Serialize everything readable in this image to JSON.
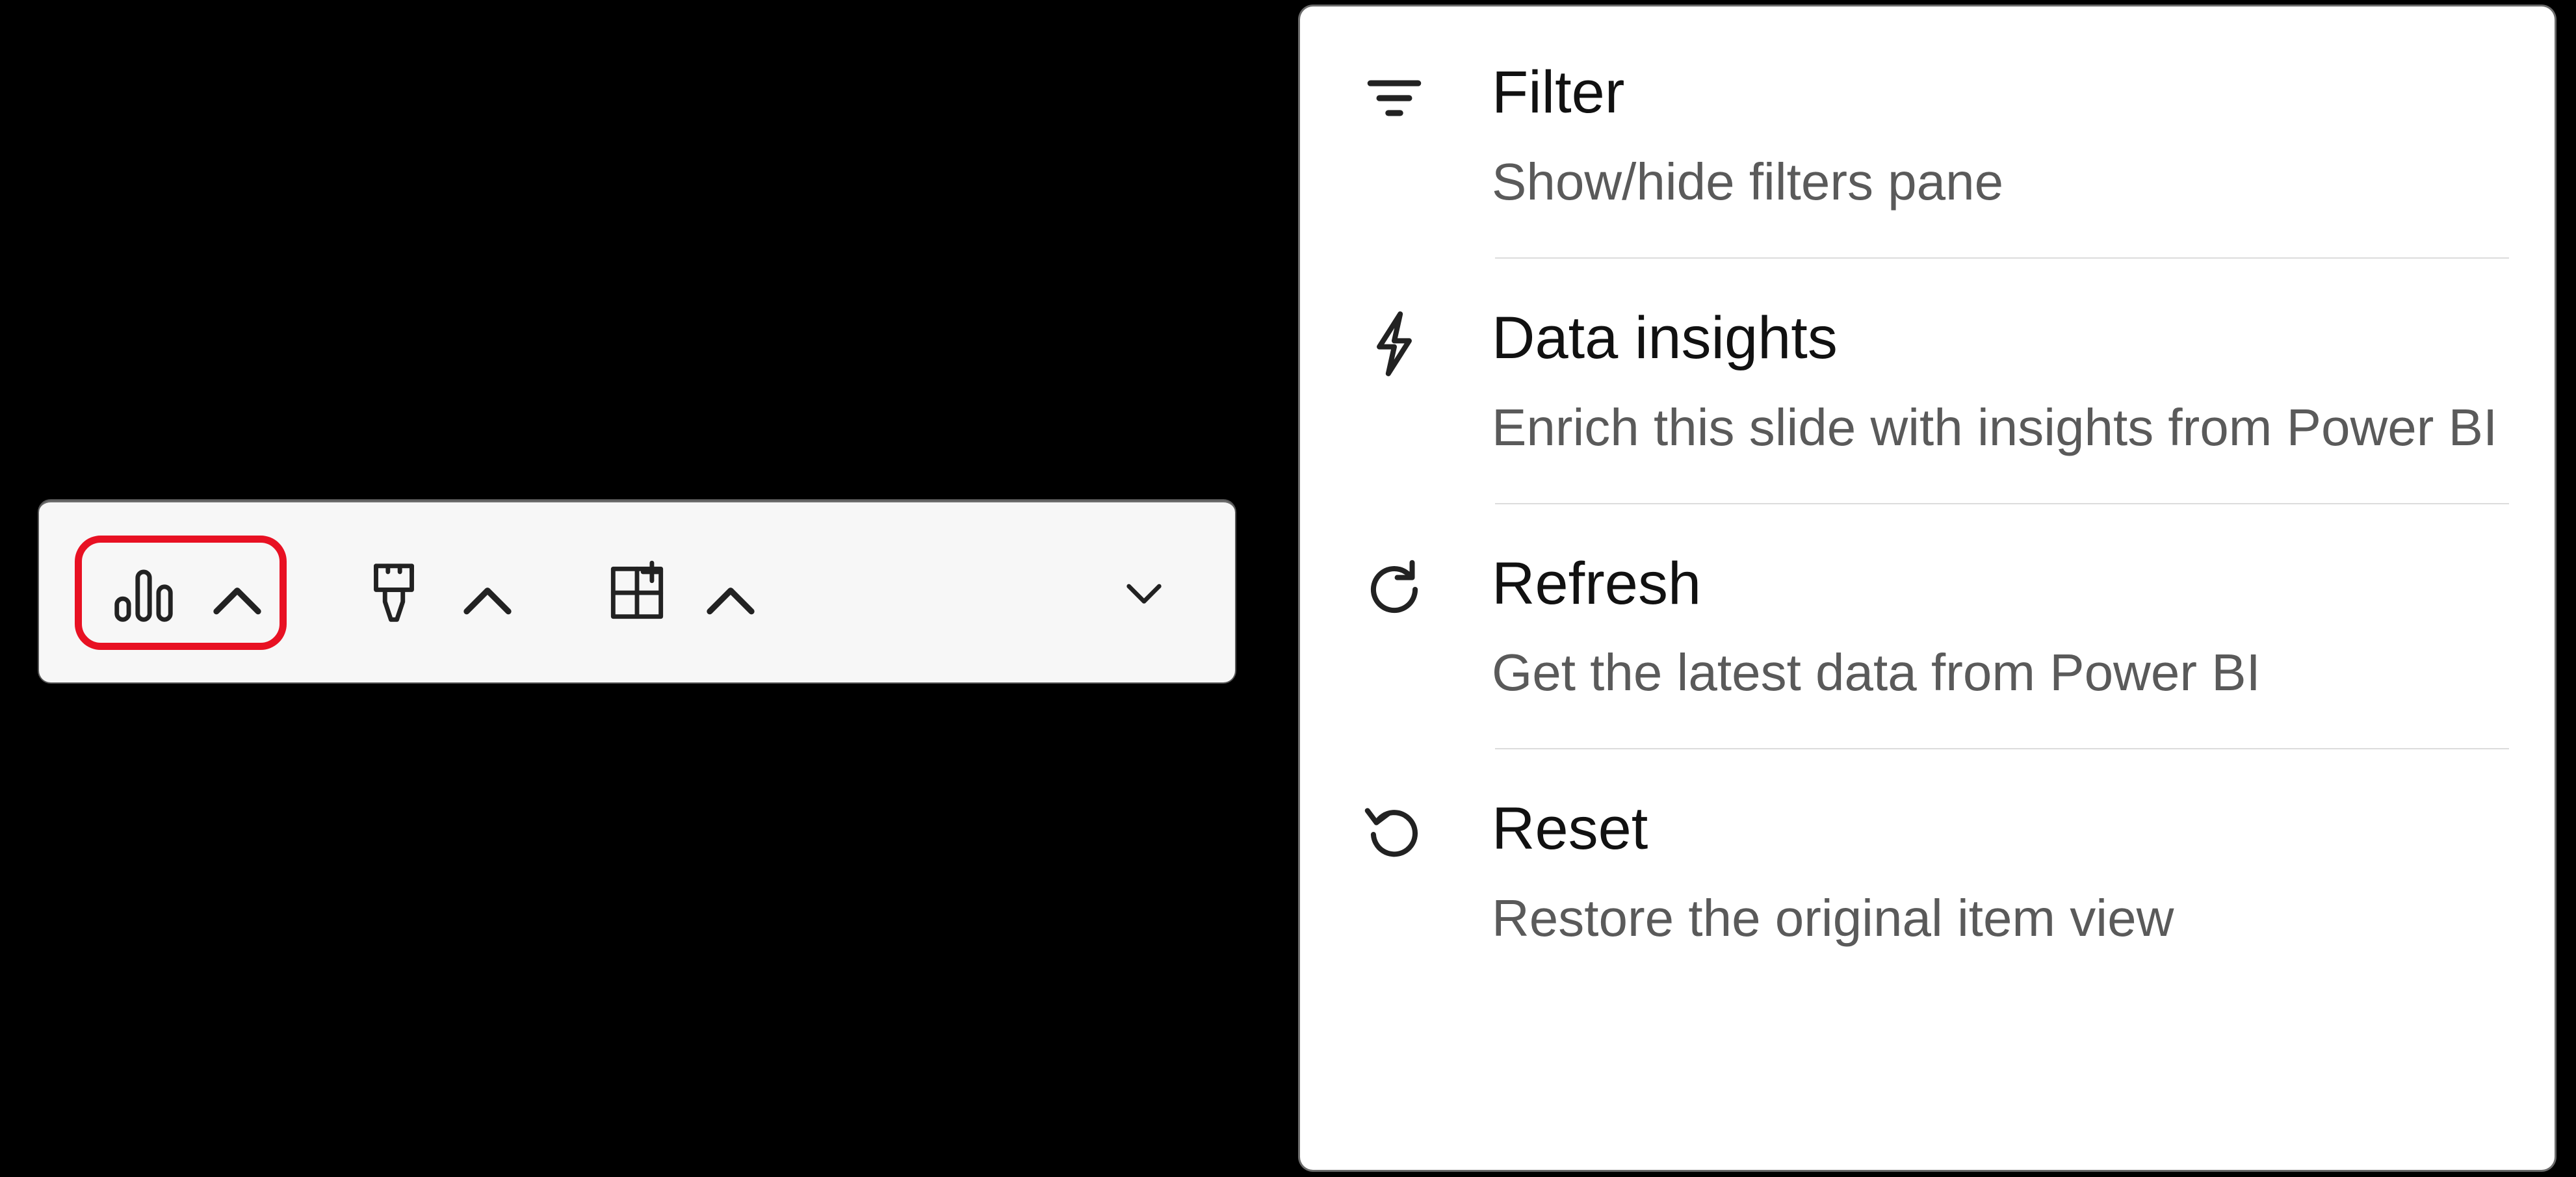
{
  "toolbar": {
    "items": [
      {
        "icon": "bar-chart-icon",
        "expanded": true,
        "highlighted": true
      },
      {
        "icon": "paintbrush-icon",
        "expanded": true,
        "highlighted": false
      },
      {
        "icon": "add-grid-icon",
        "expanded": true,
        "highlighted": false
      }
    ],
    "trailing_chevron_expanded": false
  },
  "menu": {
    "items": [
      {
        "icon": "filter-icon",
        "title": "Filter",
        "description": "Show/hide filters pane"
      },
      {
        "icon": "lightning-icon",
        "title": "Data insights",
        "description": "Enrich this slide with insights from Power BI"
      },
      {
        "icon": "refresh-icon",
        "title": "Refresh",
        "description": "Get the latest data from Power BI"
      },
      {
        "icon": "reset-icon",
        "title": "Reset",
        "description": "Restore the original item view"
      }
    ]
  }
}
